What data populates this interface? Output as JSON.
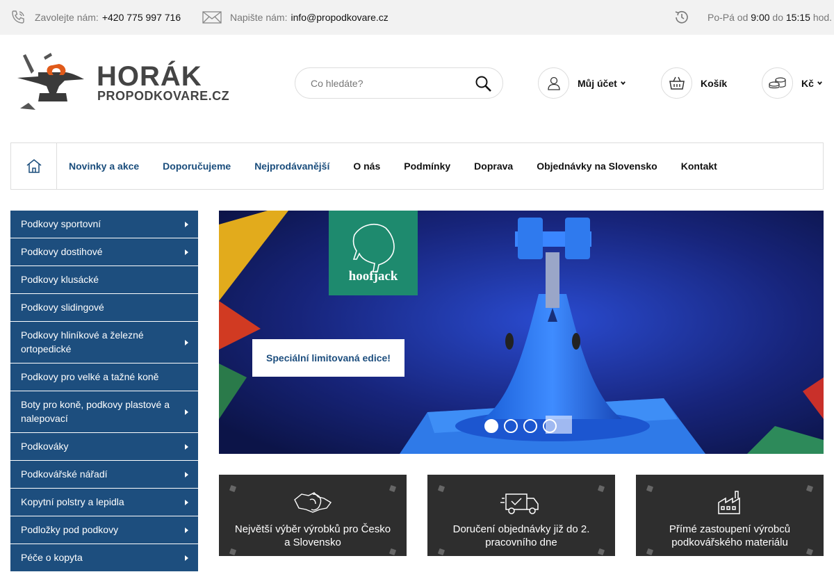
{
  "topbar": {
    "phone_label": "Zavolejte nám:",
    "phone_value": "+420 775 997 716",
    "email_label": "Napište nám:",
    "email_value": "info@propodkovare.cz",
    "hours_prefix": "Po-Pá od",
    "hours_from": "9:00",
    "hours_mid": "do",
    "hours_to": "15:15",
    "hours_suffix": "hod."
  },
  "logo": {
    "line1": "HORÁK",
    "line2": "PROPODKOVARE.CZ"
  },
  "search": {
    "placeholder": "Co hledáte?"
  },
  "header": {
    "account_label": "Můj účet",
    "cart_label": "Košík",
    "currency_label": "Kč"
  },
  "nav": {
    "items": [
      {
        "label": "Novinky a akce"
      },
      {
        "label": "Doporučujeme"
      },
      {
        "label": "Nejprodávanější"
      },
      {
        "label": "O nás"
      },
      {
        "label": "Podmínky"
      },
      {
        "label": "Doprava"
      },
      {
        "label": "Objednávky na Slovensko"
      },
      {
        "label": "Kontakt"
      }
    ]
  },
  "sidebar": {
    "items": [
      {
        "label": "Podkovy sportovní",
        "has_sub": true
      },
      {
        "label": "Podkovy dostihové",
        "has_sub": true
      },
      {
        "label": "Podkovy klusácké",
        "has_sub": false
      },
      {
        "label": "Podkovy slidingové",
        "has_sub": false
      },
      {
        "label": "Podkovy hliníkové a železné ortopedické",
        "has_sub": true
      },
      {
        "label": "Podkovy pro velké a tažné koně",
        "has_sub": false
      },
      {
        "label": "Boty pro koně, podkovy plastové a nalepovací",
        "has_sub": true
      },
      {
        "label": "Podkováky",
        "has_sub": true
      },
      {
        "label": "Podkovářské nářadí",
        "has_sub": true
      },
      {
        "label": "Kopytní polstry a lepidla",
        "has_sub": true
      },
      {
        "label": "Podložky pod podkovy",
        "has_sub": true
      },
      {
        "label": "Péče o kopyta",
        "has_sub": true
      }
    ]
  },
  "banner": {
    "brand": "hoofjack",
    "cta_label": "Speciální limitovaná edice!",
    "slides": 4,
    "active_slide": 1
  },
  "features": [
    {
      "text": "Největší výběr výrobků pro Česko a Slovensko",
      "icon": "cz-sk-map-icon"
    },
    {
      "text": "Doručení objednávky již do 2. pracovního dne",
      "icon": "delivery-truck-icon"
    },
    {
      "text": "Přímé zastoupení výrobců podkovářského materiálu",
      "icon": "factory-icon"
    }
  ],
  "colors": {
    "nav_blue": "#1a4d7c",
    "sidebar_bg": "#1d4e7e",
    "feature_bg": "#2e2e2e",
    "topbar_bg": "#f2f2f2"
  }
}
